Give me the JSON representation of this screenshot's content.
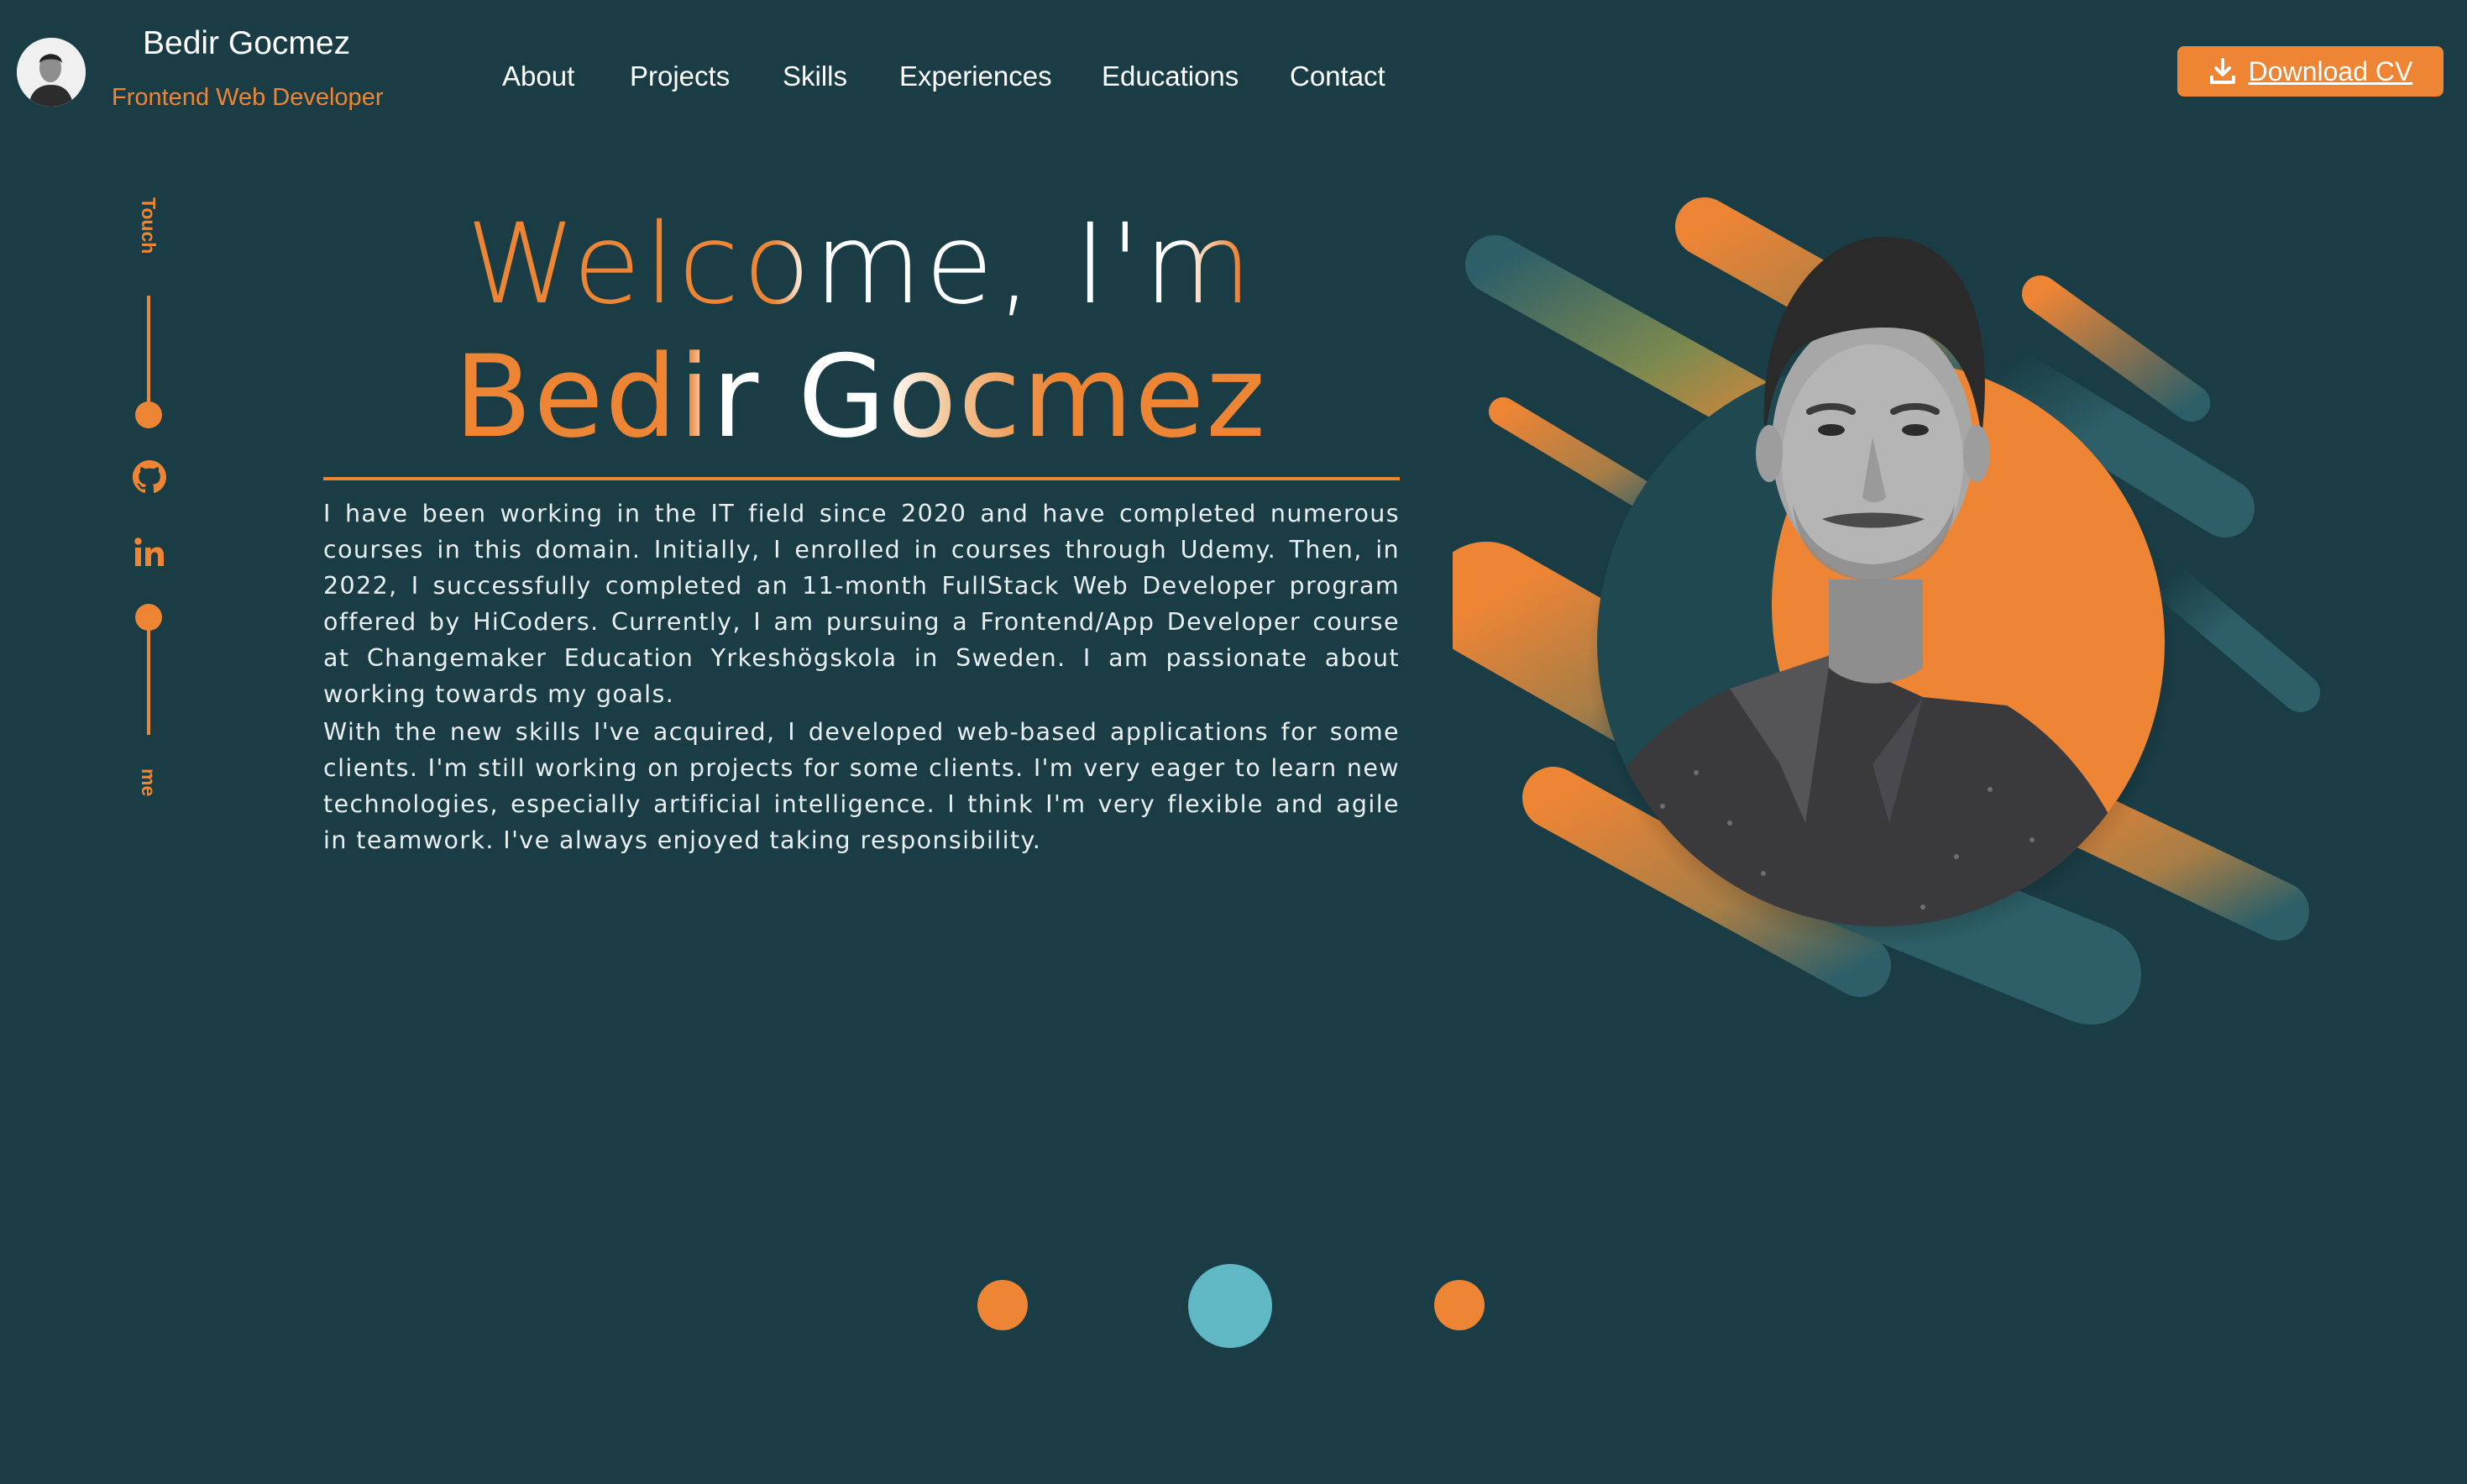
{
  "header": {
    "brand_name": "Bedir Gocmez",
    "brand_role": "Frontend Web Developer",
    "nav": [
      "About",
      "Projects",
      "Skills",
      "Experiences",
      "Educations",
      "Contact"
    ],
    "cv_button": "Download CV"
  },
  "social_rail": {
    "top_text": "Touch",
    "bottom_text": "me",
    "icons": [
      "github-icon",
      "linkedin-icon"
    ]
  },
  "hero": {
    "welcome": "Welcome, I'm",
    "name": "Bedir Gocmez",
    "bio_1": "I have been working in the IT field since 2020 and have completed numerous courses in this domain. Initially, I enrolled in courses through Udemy. Then, in 2022, I successfully completed an 11-month FullStack Web Developer program offered by HiCoders. Currently, I am pursuing a Frontend/App Developer course at Changemaker Education Yrkeshögskola in Sweden. I am passionate about working towards my goals.",
    "bio_2": "With the new skills I've acquired, I developed web-based applications for some clients. I'm still working on projects for some clients. I'm very eager to learn new technologies, especially artificial intelligence. I think I'm very flexible and agile in teamwork. I've always enjoyed taking responsibility."
  },
  "pager": {
    "dots": 3,
    "active": 2
  },
  "colors": {
    "background": "#1a3d45",
    "accent": "#ee8535",
    "teal": "#2e5f68",
    "active_dot": "#5fb8c4",
    "text": "#ffffff"
  }
}
